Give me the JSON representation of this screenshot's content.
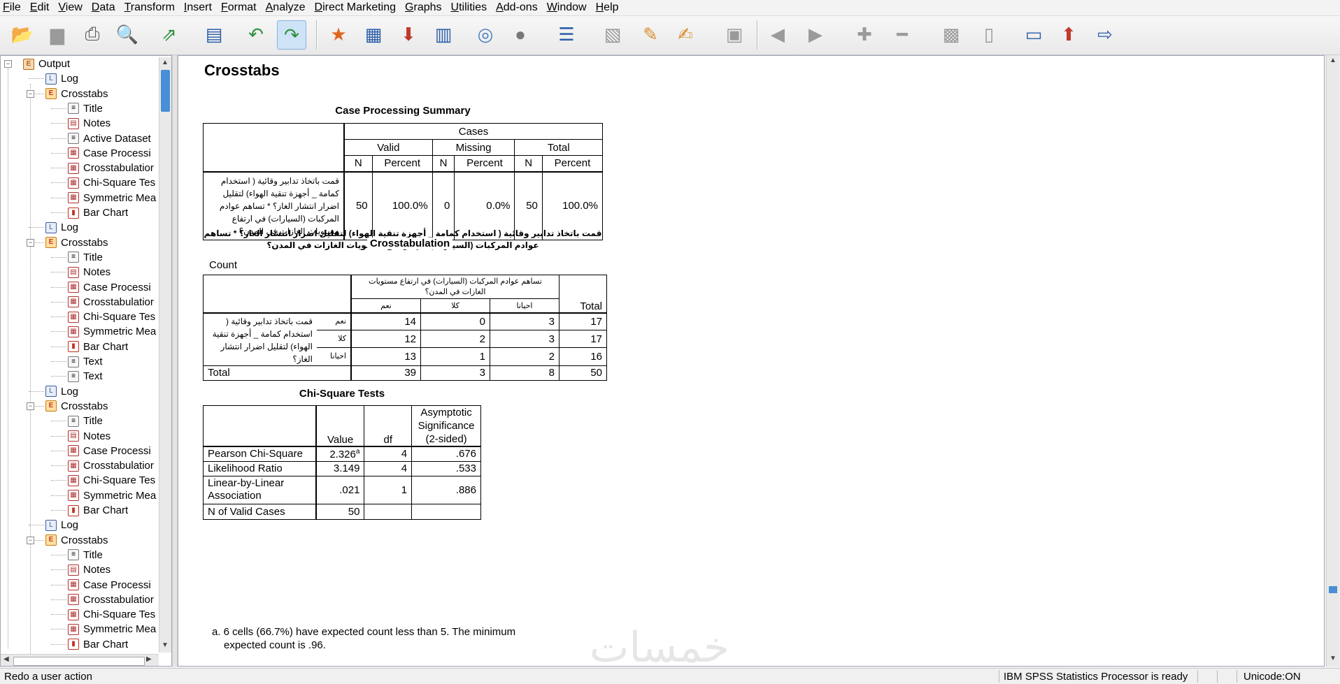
{
  "menu": [
    "File",
    "Edit",
    "View",
    "Data",
    "Transform",
    "Insert",
    "Format",
    "Analyze",
    "Direct Marketing",
    "Graphs",
    "Utilities",
    "Add-ons",
    "Window",
    "Help"
  ],
  "toolbar_icons": [
    "open-icon",
    "save-icon",
    "print-icon",
    "print-preview-icon",
    "export-icon",
    "recall-dialog-icon",
    "undo-icon",
    "redo-icon",
    "goto-data-icon",
    "goto-case-icon",
    "insert-output-icon",
    "variables-icon",
    "select-icon",
    "select-last-icon",
    "designate-window-icon",
    "hide-icon",
    "new-heading-icon",
    "new-title-icon",
    "new-text-icon",
    "insert-page-break-icon",
    "promote-icon",
    "demote-icon",
    "expand-icon",
    "collapse-icon",
    "show-icon",
    "hide-item-icon",
    "dialog-icon",
    "insert-new-icon",
    "export-output-icon"
  ],
  "outline": [
    {
      "label": "Output",
      "level": 0,
      "icon": "output",
      "exp": "-"
    },
    {
      "label": "Log",
      "level": 1,
      "icon": "log"
    },
    {
      "label": "Crosstabs",
      "level": 1,
      "icon": "crosstabs",
      "exp": "-"
    },
    {
      "label": "Title",
      "level": 2,
      "icon": "doc"
    },
    {
      "label": "Notes",
      "level": 2,
      "icon": "notes"
    },
    {
      "label": "Active Dataset",
      "level": 2,
      "icon": "doc"
    },
    {
      "label": "Case Processi",
      "level": 2,
      "icon": "table"
    },
    {
      "label": "Crosstabulatior",
      "level": 2,
      "icon": "table"
    },
    {
      "label": "Chi-Square Tes",
      "level": 2,
      "icon": "table"
    },
    {
      "label": "Symmetric Mea",
      "level": 2,
      "icon": "table"
    },
    {
      "label": "Bar Chart",
      "level": 2,
      "icon": "chart"
    },
    {
      "label": "Log",
      "level": 1,
      "icon": "log"
    },
    {
      "label": "Crosstabs",
      "level": 1,
      "icon": "crosstabs",
      "exp": "-"
    },
    {
      "label": "Title",
      "level": 2,
      "icon": "doc"
    },
    {
      "label": "Notes",
      "level": 2,
      "icon": "notes"
    },
    {
      "label": "Case Processi",
      "level": 2,
      "icon": "table"
    },
    {
      "label": "Crosstabulatior",
      "level": 2,
      "icon": "table"
    },
    {
      "label": "Chi-Square Tes",
      "level": 2,
      "icon": "table"
    },
    {
      "label": "Symmetric Mea",
      "level": 2,
      "icon": "table"
    },
    {
      "label": "Bar Chart",
      "level": 2,
      "icon": "chart"
    },
    {
      "label": "Text",
      "level": 2,
      "icon": "doc"
    },
    {
      "label": "Text",
      "level": 2,
      "icon": "doc"
    },
    {
      "label": "Log",
      "level": 1,
      "icon": "log"
    },
    {
      "label": "Crosstabs",
      "level": 1,
      "icon": "crosstabs",
      "exp": "-"
    },
    {
      "label": "Title",
      "level": 2,
      "icon": "doc"
    },
    {
      "label": "Notes",
      "level": 2,
      "icon": "notes"
    },
    {
      "label": "Case Processi",
      "level": 2,
      "icon": "table"
    },
    {
      "label": "Crosstabulatior",
      "level": 2,
      "icon": "table"
    },
    {
      "label": "Chi-Square Tes",
      "level": 2,
      "icon": "table"
    },
    {
      "label": "Symmetric Mea",
      "level": 2,
      "icon": "table"
    },
    {
      "label": "Bar Chart",
      "level": 2,
      "icon": "chart"
    },
    {
      "label": "Log",
      "level": 1,
      "icon": "log"
    },
    {
      "label": "Crosstabs",
      "level": 1,
      "icon": "crosstabs",
      "exp": "-"
    },
    {
      "label": "Title",
      "level": 2,
      "icon": "doc"
    },
    {
      "label": "Notes",
      "level": 2,
      "icon": "notes"
    },
    {
      "label": "Case Processi",
      "level": 2,
      "icon": "table"
    },
    {
      "label": "Crosstabulatior",
      "level": 2,
      "icon": "table"
    },
    {
      "label": "Chi-Square Tes",
      "level": 2,
      "icon": "table"
    },
    {
      "label": "Symmetric Mea",
      "level": 2,
      "icon": "table"
    },
    {
      "label": "Bar Chart",
      "level": 2,
      "icon": "chart"
    }
  ],
  "output": {
    "heading": "Crosstabs",
    "case_summary": {
      "title": "Case Processing Summary",
      "cases": "Cases",
      "valid": "Valid",
      "missing": "Missing",
      "total": "Total",
      "n": "N",
      "percent": "Percent",
      "row_label": "قمت باتخاذ تدابير وقائية ( استخدام كمامة _ أجهزة تنقية الهواء) لتقليل اضرار انتشار الغاز؟ * تساهم عوادم المركبات (السيارات) في ارتفاع مستويات الغازات في المدن؟",
      "values": [
        "50",
        "100.0%",
        "0",
        "0.0%",
        "50",
        "100.0%"
      ]
    },
    "crosstab": {
      "title_ar": "قمت باتخاذ تدابير وقائية ( استخدام كمامة _ أجهزة تنقية الهواء) لتقليل اضرار انتشار الغاز؟ * تساهم عوادم المركبات (السيارات) في ارتفاع مستويات الغازات في المدن؟",
      "title_en": "Crosstabulation",
      "count_label": "Count",
      "col_var": "تساهم عوادم المركبات (السيارات) في ارتفاع مستويات الغازات في المدن؟",
      "total_label": "Total",
      "row_var": "قمت باتخاذ تدابير وقائية ( استخدام كمامة _ أجهزة تنقية الهواء) لتقليل اضرار انتشار الغاز؟",
      "col_cats": [
        "نعم",
        "كلا",
        "احيانا"
      ],
      "rows": [
        {
          "cat": "نعم",
          "values": [
            "14",
            "0",
            "3",
            "17"
          ]
        },
        {
          "cat": "كلا",
          "values": [
            "12",
            "2",
            "3",
            "17"
          ]
        },
        {
          "cat": "احيانا",
          "values": [
            "13",
            "1",
            "2",
            "16"
          ]
        }
      ],
      "total_row": [
        "39",
        "3",
        "8",
        "50"
      ]
    },
    "chi": {
      "title": "Chi-Square Tests",
      "h_value": "Value",
      "h_df": "df",
      "h_sig1": "Asymptotic",
      "h_sig2": "Significance",
      "h_sig3": "(2-sided)",
      "rows": [
        {
          "label": "Pearson Chi-Square",
          "value": "2.326",
          "sup": "a",
          "df": "4",
          "sig": ".676"
        },
        {
          "label": "Likelihood Ratio",
          "value": "3.149",
          "sup": "",
          "df": "4",
          "sig": ".533"
        },
        {
          "label": "Linear-by-Linear Association",
          "value": ".021",
          "sup": "",
          "df": "1",
          "sig": ".886"
        },
        {
          "label": "N of Valid Cases",
          "value": "50",
          "sup": "",
          "df": "",
          "sig": ""
        }
      ],
      "footnote1": "a. 6 cells (66.7%) have expected count less than 5. The minimum",
      "footnote2": "expected count is .96."
    }
  },
  "watermark": "خمسات",
  "status": {
    "left": "Redo a user action",
    "processor": "IBM SPSS Statistics Processor is ready",
    "unicode": "Unicode:ON"
  }
}
